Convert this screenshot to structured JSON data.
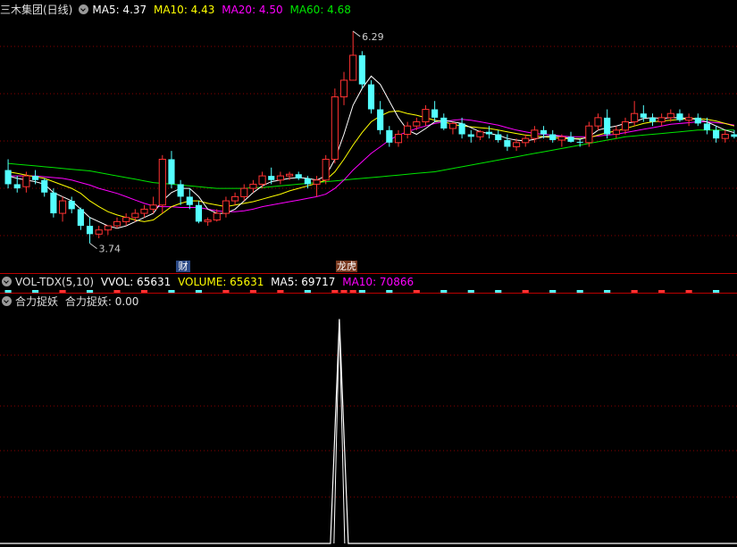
{
  "header": {
    "stock_name": "三木集团(日线)",
    "ma5": "MA5: 4.37",
    "ma10": "MA10: 4.43",
    "ma20": "MA20: 4.50",
    "ma60": "MA60: 4.68"
  },
  "volume_panel": {
    "title": "VOL-TDX(5,10)",
    "vvol": "VVOL: 65631",
    "volume": "VOLUME: 65631",
    "ma5": "MA5: 69717",
    "ma10": "MA10: 70866"
  },
  "indicator_panel": {
    "title": "合力捉妖",
    "value": "合力捉妖: 0.00"
  },
  "markers": {
    "cai": "财",
    "longhu": "龙虎"
  },
  "colors": {
    "up": "#ff3232",
    "down": "#54ffff",
    "ma5": "#ffffff",
    "ma10": "#ffff00",
    "ma20": "#ff00ff",
    "ma60": "#00e600",
    "grid": "#8b0000",
    "divider": "#b00000"
  },
  "chart_data": {
    "type": "candlestick",
    "ylim": [
      3.5,
      6.45
    ],
    "max_label": "6.29",
    "min_label": "3.74",
    "candles": [
      [
        4.62,
        4.75,
        4.4,
        4.45
      ],
      [
        4.45,
        4.55,
        4.35,
        4.4
      ],
      [
        4.42,
        4.6,
        4.35,
        4.55
      ],
      [
        4.55,
        4.62,
        4.45,
        4.5
      ],
      [
        4.5,
        4.52,
        4.3,
        4.35
      ],
      [
        4.35,
        4.4,
        4.05,
        4.1
      ],
      [
        4.1,
        4.3,
        4.0,
        4.25
      ],
      [
        4.25,
        4.3,
        4.1,
        4.15
      ],
      [
        4.15,
        4.17,
        3.9,
        3.95
      ],
      [
        3.95,
        4.05,
        3.74,
        3.85
      ],
      [
        3.85,
        3.95,
        3.8,
        3.9
      ],
      [
        3.9,
        3.95,
        3.84,
        3.95
      ],
      [
        3.95,
        4.05,
        3.92,
        4.0
      ],
      [
        4.0,
        4.1,
        3.95,
        4.05
      ],
      [
        4.05,
        4.15,
        4.0,
        4.1
      ],
      [
        4.1,
        4.2,
        4.05,
        4.15
      ],
      [
        4.15,
        4.3,
        4.1,
        4.2
      ],
      [
        4.2,
        4.8,
        4.1,
        4.75
      ],
      [
        4.75,
        4.85,
        4.4,
        4.45
      ],
      [
        4.45,
        4.5,
        4.2,
        4.3
      ],
      [
        4.3,
        4.4,
        4.15,
        4.2
      ],
      [
        4.2,
        4.25,
        3.98,
        4.0
      ],
      [
        4.0,
        4.05,
        3.95,
        4.02
      ],
      [
        4.02,
        4.15,
        4.0,
        4.1
      ],
      [
        4.1,
        4.3,
        4.05,
        4.25
      ],
      [
        4.25,
        4.35,
        4.2,
        4.3
      ],
      [
        4.3,
        4.45,
        4.25,
        4.4
      ],
      [
        4.4,
        4.5,
        4.35,
        4.45
      ],
      [
        4.45,
        4.6,
        4.4,
        4.55
      ],
      [
        4.55,
        4.65,
        4.45,
        4.5
      ],
      [
        4.5,
        4.6,
        4.45,
        4.55
      ],
      [
        4.55,
        4.6,
        4.5,
        4.57
      ],
      [
        4.57,
        4.6,
        4.5,
        4.52
      ],
      [
        4.52,
        4.55,
        4.4,
        4.45
      ],
      [
        4.45,
        4.55,
        4.3,
        4.5
      ],
      [
        4.5,
        4.8,
        4.45,
        4.75
      ],
      [
        4.75,
        5.6,
        4.7,
        5.5
      ],
      [
        5.5,
        5.8,
        5.4,
        5.7
      ],
      [
        5.7,
        6.29,
        5.7,
        6.0
      ],
      [
        6.0,
        6.05,
        5.6,
        5.65
      ],
      [
        5.65,
        5.7,
        5.3,
        5.35
      ],
      [
        5.35,
        5.45,
        5.05,
        5.1
      ],
      [
        5.1,
        5.15,
        4.9,
        4.95
      ],
      [
        4.95,
        5.1,
        4.9,
        5.05
      ],
      [
        5.05,
        5.2,
        5.0,
        5.15
      ],
      [
        5.15,
        5.25,
        5.1,
        5.2
      ],
      [
        5.2,
        5.4,
        5.15,
        5.35
      ],
      [
        5.35,
        5.45,
        5.2,
        5.25
      ],
      [
        5.25,
        5.3,
        5.1,
        5.12
      ],
      [
        5.12,
        5.2,
        5.05,
        5.18
      ],
      [
        5.18,
        5.25,
        5.0,
        5.05
      ],
      [
        5.05,
        5.1,
        4.95,
        5.02
      ],
      [
        5.02,
        5.1,
        4.98,
        5.08
      ],
      [
        5.08,
        5.15,
        5.0,
        5.05
      ],
      [
        5.05,
        5.1,
        4.95,
        4.98
      ],
      [
        4.98,
        5.05,
        4.85,
        4.9
      ],
      [
        4.9,
        5.0,
        4.85,
        4.95
      ],
      [
        4.95,
        5.05,
        4.9,
        5.0
      ],
      [
        5.0,
        5.15,
        4.95,
        5.1
      ],
      [
        5.1,
        5.15,
        5.0,
        5.05
      ],
      [
        5.05,
        5.1,
        4.95,
        4.98
      ],
      [
        4.98,
        5.05,
        4.9,
        5.02
      ],
      [
        5.02,
        5.08,
        4.95,
        4.96
      ],
      [
        4.96,
        5.0,
        4.9,
        4.95
      ],
      [
        4.95,
        5.2,
        4.9,
        5.15
      ],
      [
        5.15,
        5.3,
        5.1,
        5.25
      ],
      [
        5.25,
        5.35,
        5.0,
        5.05
      ],
      [
        5.05,
        5.15,
        5.0,
        5.1
      ],
      [
        5.1,
        5.25,
        5.05,
        5.2
      ],
      [
        5.2,
        5.45,
        5.15,
        5.3
      ],
      [
        5.3,
        5.4,
        5.2,
        5.25
      ],
      [
        5.25,
        5.3,
        5.15,
        5.2
      ],
      [
        5.2,
        5.3,
        5.15,
        5.25
      ],
      [
        5.25,
        5.35,
        5.2,
        5.3
      ],
      [
        5.3,
        5.35,
        5.2,
        5.22
      ],
      [
        5.22,
        5.3,
        5.15,
        5.25
      ],
      [
        5.25,
        5.3,
        5.15,
        5.18
      ],
      [
        5.18,
        5.25,
        5.05,
        5.1
      ],
      [
        5.1,
        5.15,
        4.95,
        5.0
      ],
      [
        5.0,
        5.1,
        4.95,
        5.05
      ],
      [
        5.05,
        5.1,
        5.0,
        5.02
      ]
    ],
    "ma5": [
      4.55,
      4.52,
      4.5,
      4.48,
      4.45,
      4.35,
      4.3,
      4.25,
      4.15,
      4.05,
      4.0,
      3.95,
      3.92,
      3.95,
      4.0,
      4.05,
      4.1,
      4.25,
      4.35,
      4.4,
      4.4,
      4.3,
      4.15,
      4.1,
      4.1,
      4.15,
      4.25,
      4.35,
      4.43,
      4.48,
      4.5,
      4.52,
      4.53,
      4.52,
      4.5,
      4.55,
      4.75,
      5.05,
      5.4,
      5.6,
      5.75,
      5.65,
      5.45,
      5.25,
      5.1,
      5.05,
      5.12,
      5.2,
      5.22,
      5.2,
      5.18,
      5.13,
      5.08,
      5.06,
      5.04,
      5.0,
      4.98,
      4.97,
      4.99,
      5.02,
      5.03,
      5.02,
      5.0,
      4.99,
      5.02,
      5.1,
      5.13,
      5.15,
      5.18,
      5.2,
      5.24,
      5.25,
      5.24,
      5.25,
      5.25,
      5.24,
      5.23,
      5.2,
      5.15,
      5.1,
      5.07
    ],
    "ma10": [
      4.6,
      4.58,
      4.56,
      4.54,
      4.52,
      4.48,
      4.44,
      4.4,
      4.34,
      4.25,
      4.18,
      4.12,
      4.08,
      4.05,
      4.02,
      4.0,
      4.02,
      4.1,
      4.18,
      4.22,
      4.25,
      4.25,
      4.22,
      4.2,
      4.18,
      4.2,
      4.22,
      4.24,
      4.27,
      4.3,
      4.33,
      4.37,
      4.4,
      4.43,
      4.46,
      4.5,
      4.6,
      4.75,
      4.92,
      5.07,
      5.2,
      5.27,
      5.32,
      5.33,
      5.3,
      5.28,
      5.25,
      5.22,
      5.2,
      5.17,
      5.15,
      5.14,
      5.13,
      5.12,
      5.1,
      5.08,
      5.06,
      5.04,
      5.03,
      5.02,
      5.01,
      5.0,
      5.0,
      5.0,
      5.01,
      5.04,
      5.07,
      5.09,
      5.12,
      5.15,
      5.18,
      5.2,
      5.21,
      5.22,
      5.23,
      5.24,
      5.24,
      5.23,
      5.21,
      5.18,
      5.15
    ],
    "ma20": [
      4.55,
      4.55,
      4.55,
      4.55,
      4.54,
      4.53,
      4.52,
      4.5,
      4.47,
      4.44,
      4.4,
      4.37,
      4.34,
      4.3,
      4.26,
      4.22,
      4.19,
      4.18,
      4.18,
      4.17,
      4.17,
      4.17,
      4.15,
      4.13,
      4.12,
      4.12,
      4.13,
      4.15,
      4.18,
      4.2,
      4.22,
      4.24,
      4.26,
      4.28,
      4.3,
      4.33,
      4.4,
      4.5,
      4.62,
      4.72,
      4.82,
      4.9,
      4.98,
      5.04,
      5.08,
      5.12,
      5.15,
      5.18,
      5.2,
      5.22,
      5.23,
      5.22,
      5.2,
      5.18,
      5.16,
      5.13,
      5.1,
      5.08,
      5.06,
      5.05,
      5.04,
      5.03,
      5.02,
      5.02,
      5.02,
      5.03,
      5.04,
      5.05,
      5.07,
      5.09,
      5.11,
      5.13,
      5.15,
      5.17,
      5.18,
      5.19,
      5.2,
      5.2,
      5.19,
      5.18,
      5.16
    ],
    "ma60": [
      4.7,
      4.69,
      4.68,
      4.67,
      4.66,
      4.65,
      4.64,
      4.63,
      4.62,
      4.61,
      4.59,
      4.57,
      4.55,
      4.53,
      4.51,
      4.49,
      4.47,
      4.46,
      4.45,
      4.44,
      4.43,
      4.42,
      4.41,
      4.4,
      4.4,
      4.4,
      4.4,
      4.41,
      4.41,
      4.42,
      4.43,
      4.44,
      4.45,
      4.46,
      4.47,
      4.48,
      4.49,
      4.5,
      4.51,
      4.52,
      4.53,
      4.54,
      4.55,
      4.56,
      4.57,
      4.58,
      4.59,
      4.6,
      4.62,
      4.64,
      4.66,
      4.68,
      4.7,
      4.72,
      4.74,
      4.76,
      4.78,
      4.8,
      4.82,
      4.84,
      4.86,
      4.88,
      4.9,
      4.92,
      4.94,
      4.96,
      4.98,
      5.0,
      5.02,
      5.03,
      5.04,
      5.05,
      5.06,
      5.07,
      5.08,
      5.09,
      5.1,
      5.1,
      5.1,
      5.1,
      5.1
    ],
    "indicator": {
      "spike_index": 36,
      "spike_value": 1.0,
      "ylim": [
        0,
        1.05
      ]
    }
  }
}
